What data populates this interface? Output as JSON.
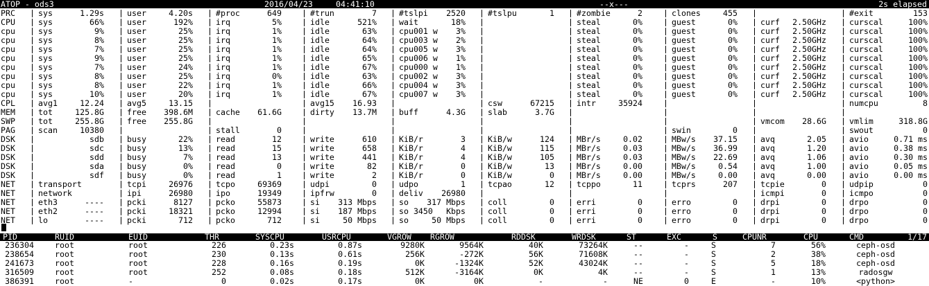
{
  "header": {
    "left": "ATOP - ods3",
    "date": "2016/04/23",
    "time": "04:41:10",
    "flags": "--x---",
    "elapsed": "2s elapsed"
  },
  "system_rows": [
    {
      "label": "PRC",
      "fields": [
        [
          "sys",
          "1.29s"
        ],
        [
          "user",
          "4.20s"
        ],
        [
          "#proc",
          "649"
        ],
        [
          "#trun",
          "7"
        ],
        [
          "#tslpi",
          "2520"
        ],
        [
          "#tslpu",
          "1"
        ],
        [
          "#zombie",
          "2"
        ],
        [
          "clones",
          "455"
        ],
        [
          "",
          ""
        ],
        [
          "#exit",
          "153"
        ]
      ]
    },
    {
      "label": "CPU",
      "fields": [
        [
          "sys",
          "66%"
        ],
        [
          "user",
          "192%"
        ],
        [
          "irq",
          "5%"
        ],
        [
          "idle",
          "521%"
        ],
        [
          "wait",
          "18%"
        ],
        [
          "",
          ""
        ],
        [
          "steal",
          "0%"
        ],
        [
          "guest",
          "0%"
        ],
        [
          "curf",
          "2.50GHz"
        ],
        [
          "curscal",
          "100%"
        ]
      ]
    },
    {
      "label": "cpu",
      "fields": [
        [
          "sys",
          "9%"
        ],
        [
          "user",
          "25%"
        ],
        [
          "irq",
          "1%"
        ],
        [
          "idle",
          "63%"
        ],
        [
          "cpu001 w",
          "3%"
        ],
        [
          "",
          ""
        ],
        [
          "steal",
          "0%"
        ],
        [
          "guest",
          "0%"
        ],
        [
          "curf",
          "2.50GHz"
        ],
        [
          "curscal",
          "100%"
        ]
      ]
    },
    {
      "label": "cpu",
      "fields": [
        [
          "sys",
          "8%"
        ],
        [
          "user",
          "25%"
        ],
        [
          "irq",
          "1%"
        ],
        [
          "idle",
          "64%"
        ],
        [
          "cpu003 w",
          "2%"
        ],
        [
          "",
          ""
        ],
        [
          "steal",
          "0%"
        ],
        [
          "guest",
          "0%"
        ],
        [
          "curf",
          "2.50GHz"
        ],
        [
          "curscal",
          "100%"
        ]
      ]
    },
    {
      "label": "cpu",
      "fields": [
        [
          "sys",
          "7%"
        ],
        [
          "user",
          "25%"
        ],
        [
          "irq",
          "1%"
        ],
        [
          "idle",
          "64%"
        ],
        [
          "cpu005 w",
          "3%"
        ],
        [
          "",
          ""
        ],
        [
          "steal",
          "0%"
        ],
        [
          "guest",
          "0%"
        ],
        [
          "curf",
          "2.50GHz"
        ],
        [
          "curscal",
          "100%"
        ]
      ]
    },
    {
      "label": "cpu",
      "fields": [
        [
          "sys",
          "9%"
        ],
        [
          "user",
          "25%"
        ],
        [
          "irq",
          "1%"
        ],
        [
          "idle",
          "65%"
        ],
        [
          "cpu006 w",
          "1%"
        ],
        [
          "",
          ""
        ],
        [
          "steal",
          "0%"
        ],
        [
          "guest",
          "0%"
        ],
        [
          "curf",
          "2.50GHz"
        ],
        [
          "curscal",
          "100%"
        ]
      ]
    },
    {
      "label": "cpu",
      "fields": [
        [
          "sys",
          "7%"
        ],
        [
          "user",
          "24%"
        ],
        [
          "irq",
          "1%"
        ],
        [
          "idle",
          "67%"
        ],
        [
          "cpu000 w",
          "1%"
        ],
        [
          "",
          ""
        ],
        [
          "steal",
          "0%"
        ],
        [
          "guest",
          "0%"
        ],
        [
          "curf",
          "2.50GHz"
        ],
        [
          "curscal",
          "100%"
        ]
      ]
    },
    {
      "label": "cpu",
      "fields": [
        [
          "sys",
          "8%"
        ],
        [
          "user",
          "25%"
        ],
        [
          "irq",
          "0%"
        ],
        [
          "idle",
          "63%"
        ],
        [
          "cpu002 w",
          "3%"
        ],
        [
          "",
          ""
        ],
        [
          "steal",
          "0%"
        ],
        [
          "guest",
          "0%"
        ],
        [
          "curf",
          "2.50GHz"
        ],
        [
          "curscal",
          "100%"
        ]
      ]
    },
    {
      "label": "cpu",
      "fields": [
        [
          "sys",
          "8%"
        ],
        [
          "user",
          "22%"
        ],
        [
          "irq",
          "1%"
        ],
        [
          "idle",
          "66%"
        ],
        [
          "cpu004 w",
          "3%"
        ],
        [
          "",
          ""
        ],
        [
          "steal",
          "0%"
        ],
        [
          "guest",
          "0%"
        ],
        [
          "curf",
          "2.50GHz"
        ],
        [
          "curscal",
          "100%"
        ]
      ]
    },
    {
      "label": "cpu",
      "fields": [
        [
          "sys",
          "10%"
        ],
        [
          "user",
          "20%"
        ],
        [
          "irq",
          "1%"
        ],
        [
          "idle",
          "67%"
        ],
        [
          "cpu007 w",
          "3%"
        ],
        [
          "",
          ""
        ],
        [
          "steal",
          "0%"
        ],
        [
          "guest",
          "0%"
        ],
        [
          "curf",
          "2.50GHz"
        ],
        [
          "curscal",
          "100%"
        ]
      ]
    },
    {
      "label": "CPL",
      "fields": [
        [
          "avg1",
          "12.24"
        ],
        [
          "avg5",
          "13.15"
        ],
        [
          "",
          ""
        ],
        [
          "avg15",
          "16.93"
        ],
        [
          "",
          ""
        ],
        [
          "csw",
          "67215"
        ],
        [
          "intr",
          "35924"
        ],
        [
          "",
          ""
        ],
        [
          "",
          ""
        ],
        [
          "numcpu",
          "8"
        ]
      ]
    },
    {
      "label": "MEM",
      "fields": [
        [
          "tot",
          "125.8G"
        ],
        [
          "free",
          "398.6M"
        ],
        [
          "cache",
          "61.6G"
        ],
        [
          "dirty",
          "13.7M"
        ],
        [
          "buff",
          "4.3G"
        ],
        [
          "slab",
          "3.7G"
        ],
        [
          "",
          ""
        ],
        [
          "",
          ""
        ],
        [
          "",
          ""
        ],
        [
          "",
          ""
        ]
      ]
    },
    {
      "label": "SWP",
      "fields": [
        [
          "tot",
          "255.8G"
        ],
        [
          "free",
          "255.8G"
        ],
        [
          "",
          ""
        ],
        [
          "",
          ""
        ],
        [
          "",
          ""
        ],
        [
          "",
          ""
        ],
        [
          "",
          ""
        ],
        [
          "",
          ""
        ],
        [
          "vmcom",
          "28.6G"
        ],
        [
          "vmlim",
          "318.8G"
        ]
      ]
    },
    {
      "label": "PAG",
      "fields": [
        [
          "scan",
          "10380"
        ],
        [
          "",
          ""
        ],
        [
          "stall",
          "0"
        ],
        [
          "",
          ""
        ],
        [
          "",
          ""
        ],
        [
          "",
          ""
        ],
        [
          "",
          ""
        ],
        [
          "swin",
          "0"
        ],
        [
          "",
          ""
        ],
        [
          "swout",
          "0"
        ]
      ]
    },
    {
      "label": "DSK",
      "fields": [
        [
          "",
          "sdb"
        ],
        [
          "busy",
          "22%"
        ],
        [
          "read",
          "12"
        ],
        [
          "write",
          "610"
        ],
        [
          "KiB/r",
          "3"
        ],
        [
          "KiB/w",
          "124"
        ],
        [
          "MBr/s",
          "0.02"
        ],
        [
          "MBw/s",
          "37.15"
        ],
        [
          "avq",
          "2.05"
        ],
        [
          "avio",
          "0.71 ms"
        ]
      ]
    },
    {
      "label": "DSK",
      "fields": [
        [
          "",
          "sdc"
        ],
        [
          "busy",
          "13%"
        ],
        [
          "read",
          "15"
        ],
        [
          "write",
          "658"
        ],
        [
          "KiB/r",
          "4"
        ],
        [
          "KiB/w",
          "115"
        ],
        [
          "MBr/s",
          "0.03"
        ],
        [
          "MBw/s",
          "36.99"
        ],
        [
          "avq",
          "1.20"
        ],
        [
          "avio",
          "0.38 ms"
        ]
      ]
    },
    {
      "label": "DSK",
      "fields": [
        [
          "",
          "sdd"
        ],
        [
          "busy",
          "7%"
        ],
        [
          "read",
          "13"
        ],
        [
          "write",
          "441"
        ],
        [
          "KiB/r",
          "4"
        ],
        [
          "KiB/w",
          "105"
        ],
        [
          "MBr/s",
          "0.03"
        ],
        [
          "MBw/s",
          "22.69"
        ],
        [
          "avq",
          "1.06"
        ],
        [
          "avio",
          "0.30 ms"
        ]
      ]
    },
    {
      "label": "DSK",
      "fields": [
        [
          "",
          "sda"
        ],
        [
          "busy",
          "0%"
        ],
        [
          "read",
          "0"
        ],
        [
          "write",
          "82"
        ],
        [
          "KiB/r",
          "0"
        ],
        [
          "KiB/w",
          "13"
        ],
        [
          "MBr/s",
          "0.00"
        ],
        [
          "MBw/s",
          "0.54"
        ],
        [
          "avq",
          "1.00"
        ],
        [
          "avio",
          "0.05 ms"
        ]
      ]
    },
    {
      "label": "DSK",
      "fields": [
        [
          "",
          "sdf"
        ],
        [
          "busy",
          "0%"
        ],
        [
          "read",
          "1"
        ],
        [
          "write",
          "2"
        ],
        [
          "KiB/r",
          "0"
        ],
        [
          "KiB/w",
          "0"
        ],
        [
          "MBr/s",
          "0.00"
        ],
        [
          "MBw/s",
          "0.00"
        ],
        [
          "avq",
          "0.00"
        ],
        [
          "avio",
          "0.00 ms"
        ]
      ]
    },
    {
      "label": "NET",
      "fields": [
        [
          "transport",
          ""
        ],
        [
          "tcpi",
          "26976"
        ],
        [
          "tcpo",
          "69369"
        ],
        [
          "udpi",
          "0"
        ],
        [
          "udpo",
          "1"
        ],
        [
          "tcpao",
          "12"
        ],
        [
          "tcppo",
          "11"
        ],
        [
          "tcprs",
          "207"
        ],
        [
          "tcpie",
          "0"
        ],
        [
          "udpip",
          "0"
        ]
      ]
    },
    {
      "label": "NET",
      "fields": [
        [
          "network",
          ""
        ],
        [
          "ipi",
          "26980"
        ],
        [
          "ipo",
          "19349"
        ],
        [
          "ipfrw",
          "0"
        ],
        [
          "deliv",
          "26980"
        ],
        [
          "",
          ""
        ],
        [
          "",
          ""
        ],
        [
          "",
          ""
        ],
        [
          "icmpi",
          "0"
        ],
        [
          "icmpo",
          "0"
        ]
      ]
    },
    {
      "label": "NET",
      "fields": [
        [
          "eth3",
          "----"
        ],
        [
          "pcki",
          "8127"
        ],
        [
          "pcko",
          "55873"
        ],
        [
          "si",
          "313 Mbps"
        ],
        [
          "so",
          "317 Mbps"
        ],
        [
          "coll",
          "0"
        ],
        [
          "erri",
          "0"
        ],
        [
          "erro",
          "0"
        ],
        [
          "drpi",
          "0"
        ],
        [
          "drpo",
          "0"
        ]
      ]
    },
    {
      "label": "NET",
      "fields": [
        [
          "eth2",
          "----"
        ],
        [
          "pcki",
          "18321"
        ],
        [
          "pcko",
          "12994"
        ],
        [
          "si",
          "187 Mbps"
        ],
        [
          "so 3450",
          "Kbps"
        ],
        [
          "coll",
          "0"
        ],
        [
          "erri",
          "0"
        ],
        [
          "erro",
          "0"
        ],
        [
          "drpi",
          "0"
        ],
        [
          "drpo",
          "0"
        ]
      ]
    },
    {
      "label": "NET",
      "fields": [
        [
          "lo",
          "----"
        ],
        [
          "pcki",
          "712"
        ],
        [
          "pcko",
          "712"
        ],
        [
          "si",
          "50 Mbps"
        ],
        [
          "so",
          "50 Mbps"
        ],
        [
          "coll",
          "0"
        ],
        [
          "erri",
          "0"
        ],
        [
          "erro",
          "0"
        ],
        [
          "drpi",
          "0"
        ],
        [
          "drpo",
          "0"
        ]
      ]
    }
  ],
  "process_table": {
    "columns": [
      "PID",
      "RUID",
      "EUID",
      "THR",
      "SYSCPU",
      "USRCPU",
      "VGROW",
      "RGROW",
      "RDDSK",
      "WRDSK",
      "ST",
      "EXC",
      "S",
      "CPUNR",
      "CPU",
      "CMD"
    ],
    "page": "1/17",
    "rows": [
      [
        "236304",
        "root",
        "root",
        "226",
        "0.23s",
        "0.87s",
        "9280K",
        "9564K",
        "40K",
        "73264K",
        "--",
        "-",
        "S",
        "7",
        "56%",
        "ceph-osd"
      ],
      [
        "238654",
        "root",
        "root",
        "230",
        "0.13s",
        "0.61s",
        "256K",
        "-272K",
        "56K",
        "71608K",
        "--",
        "-",
        "S",
        "2",
        "38%",
        "ceph-osd"
      ],
      [
        "241673",
        "root",
        "root",
        "228",
        "0.16s",
        "0.19s",
        "0K",
        "-1324K",
        "52K",
        "43024K",
        "--",
        "-",
        "S",
        "5",
        "18%",
        "ceph-osd"
      ],
      [
        "316509",
        "root",
        "root",
        "252",
        "0.08s",
        "0.18s",
        "512K",
        "-3164K",
        "0K",
        "4K",
        "--",
        "-",
        "S",
        "1",
        "13%",
        "radosgw"
      ],
      [
        "386391",
        "root",
        "-",
        "0",
        "0.02s",
        "0.17s",
        "0K",
        "0K",
        "-",
        "-",
        "NE",
        "0",
        "E",
        "-",
        "10%",
        "<python>"
      ]
    ]
  }
}
